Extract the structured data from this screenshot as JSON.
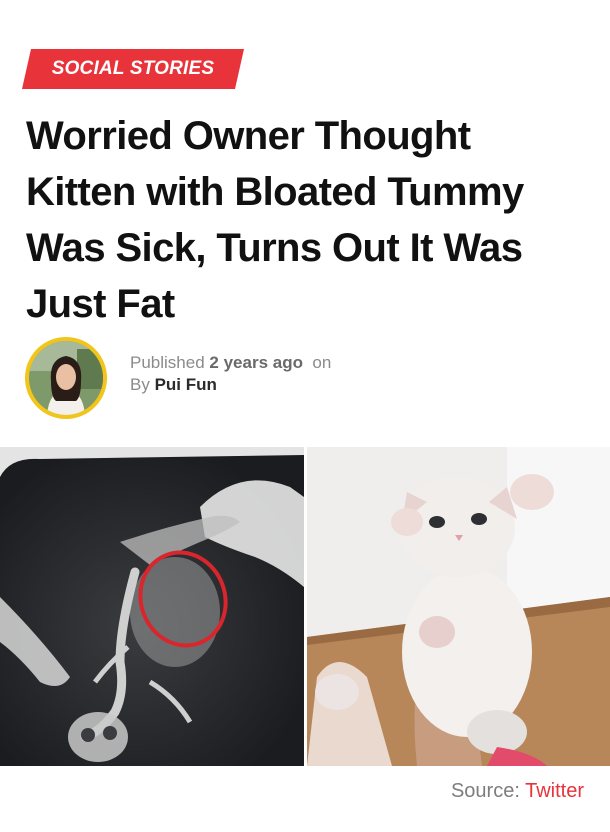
{
  "category": {
    "label": "SOCIAL STORIES",
    "color": "#e9333b"
  },
  "article": {
    "title": "Worried Owner Thought Kitten with Bloated Tummy Was Sick, Turns Out It Was Just Fat"
  },
  "byline": {
    "published_label": "Published",
    "published_when": "2 years ago",
    "on_label": "on",
    "by_label": "By",
    "author": "Pui Fun",
    "avatar_icon": "author-avatar"
  },
  "images": [
    {
      "name": "kitten-xray-image",
      "icon": "xray-photo"
    },
    {
      "name": "kitten-photo-image",
      "icon": "kitten-photo"
    }
  ],
  "source": {
    "label": "Source:",
    "link": "Twitter"
  }
}
